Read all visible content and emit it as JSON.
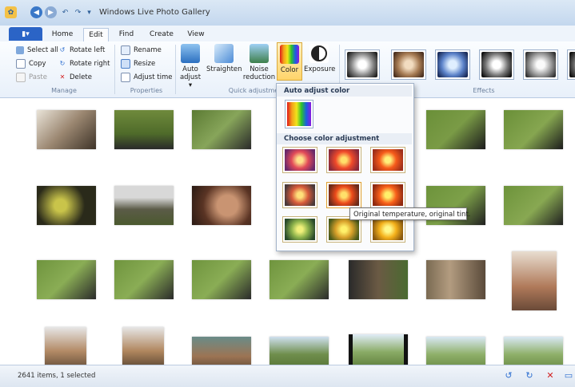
{
  "window": {
    "title": "Windows Live Photo Gallery"
  },
  "file_tab": {
    "label": "▮▾"
  },
  "tabs": [
    {
      "label": "Home"
    },
    {
      "label": "Edit"
    },
    {
      "label": "Find"
    },
    {
      "label": "Create"
    },
    {
      "label": "View"
    }
  ],
  "active_tab": "Edit",
  "ribbon": {
    "manage": {
      "select_all": "Select all",
      "copy": "Copy",
      "paste": "Paste",
      "rotate_left": "Rotate left",
      "rotate_right": "Rotate right",
      "delete": "Delete",
      "group_label": "Manage"
    },
    "properties": {
      "rename": "Rename",
      "resize": "Resize",
      "adjust_time": "Adjust time",
      "group_label": "Properties"
    },
    "quick_adjustments": {
      "auto_adjust": "Auto adjust ▾",
      "straighten": "Straighten",
      "noise_reduction": "Noise reduction",
      "color": "Color",
      "exposure": "Exposure",
      "group_label": "Quick adjustme"
    },
    "effects": {
      "group_label": "Effects"
    }
  },
  "color_dropdown": {
    "auto_header": "Auto adjust color",
    "choose_header": "Choose color adjustment"
  },
  "tooltip": "Original temperature, original tint.",
  "status": {
    "text": "2641 items, 1 selected"
  }
}
